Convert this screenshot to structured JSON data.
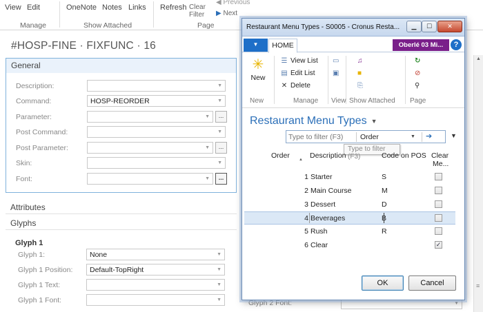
{
  "background": {
    "ribbon": {
      "view": "View",
      "edit": "Edit",
      "onenote": "OneNote",
      "notes": "Notes",
      "links": "Links",
      "refresh": "Refresh",
      "clear_filter_1": "Clear",
      "clear_filter_2": "Filter",
      "previous": "Previous",
      "next": "Next",
      "grp_manage": "Manage",
      "grp_show_attached": "Show Attached",
      "grp_page": "Page"
    },
    "record_title": "#HOSP-FINE · FIXFUNC · 16",
    "general": {
      "header": "General",
      "fields": [
        {
          "label": "Description:",
          "value": ""
        },
        {
          "label": "Command:",
          "value": "HOSP-REORDER"
        },
        {
          "label": "Parameter:",
          "value": ""
        },
        {
          "label": "Post Command:",
          "value": ""
        },
        {
          "label": "Post Parameter:",
          "value": ""
        },
        {
          "label": "Skin:",
          "value": ""
        },
        {
          "label": "Font:",
          "value": ""
        }
      ],
      "more_button": "..."
    },
    "attributes_header": "Attributes",
    "glyphs_header": "Glyphs",
    "glyph1": {
      "title": "Glyph 1",
      "fields": [
        {
          "label": "Glyph 1:",
          "value": "None"
        },
        {
          "label": "Glyph 1 Position:",
          "value": "Default-TopRight"
        },
        {
          "label": "Glyph 1 Text:",
          "value": ""
        },
        {
          "label": "Glyph 1 Font:",
          "value": ""
        }
      ]
    },
    "right_label": "Glyph 2 Font:"
  },
  "dialog": {
    "title": "Restaurant Menu Types - S0005 - Cronus Resta...",
    "tab_home": "HOME",
    "company": "Oberlé 03 Mi...",
    "ribbon": {
      "new": "New",
      "view_list": "View List",
      "edit_list": "Edit List",
      "delete": "Delete",
      "grp_new": "New",
      "grp_manage": "Manage",
      "grp_view": "View",
      "grp_show_attached": "Show Attached",
      "grp_page": "Page"
    },
    "heading": "Restaurant Menu Types",
    "filter": {
      "placeholder": "Type to filter (F3)",
      "field": "Order",
      "tooltip": "Type to filter (F3)"
    },
    "columns": {
      "order": "Order",
      "description": "Description",
      "code_on_pos": "Code on POS",
      "clear_1": "Clear",
      "clear_2": "Me..."
    },
    "rows": [
      {
        "order": "1",
        "description": "Starter",
        "code": "S",
        "clear": false
      },
      {
        "order": "2",
        "description": "Main Course",
        "code": "M",
        "clear": false
      },
      {
        "order": "3",
        "description": "Dessert",
        "code": "D",
        "clear": false
      },
      {
        "order": "4",
        "description": "Beverages",
        "code": "B",
        "clear": false
      },
      {
        "order": "5",
        "description": "Rush",
        "code": "R",
        "clear": false
      },
      {
        "order": "6",
        "description": "Clear",
        "code": "",
        "clear": true
      }
    ],
    "selected_row": 3,
    "buttons": {
      "ok": "OK",
      "cancel": "Cancel"
    }
  },
  "colors": {
    "accent": "#2b6fb8",
    "company": "#7a1f8a",
    "selection": "#dbe8f6"
  }
}
